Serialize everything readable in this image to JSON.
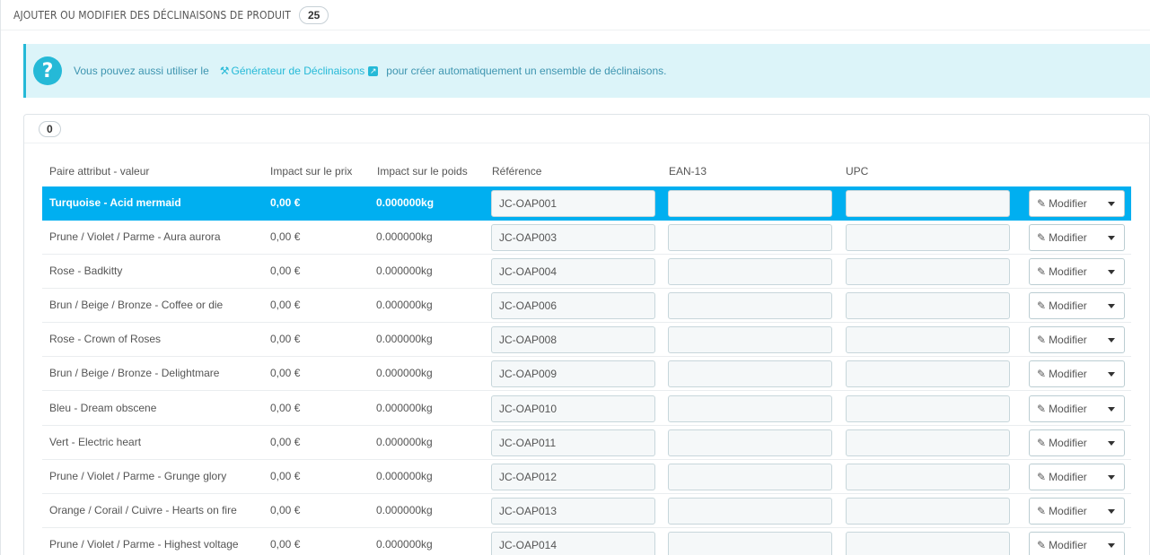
{
  "header": {
    "title": "AJOUTER OU MODIFIER DES DÉCLINAISONS DE PRODUIT",
    "count": "25"
  },
  "alert": {
    "before": "Vous pouvez aussi utiliser le",
    "link": "Générateur de Déclinaisons",
    "after": "pour créer automatiquement un ensemble de déclinaisons."
  },
  "panel": {
    "count": "0"
  },
  "table": {
    "columns": [
      "Paire attribut - valeur",
      "Impact sur le prix",
      "Impact sur le poids",
      "Référence",
      "EAN-13",
      "UPC"
    ],
    "action_label": "Modifier",
    "rows": [
      {
        "name": "Turquoise - Acid mermaid",
        "price": "0,00 €",
        "weight": "0.000000kg",
        "ref": "JC-OAP001",
        "ean": "",
        "upc": ""
      },
      {
        "name": "Prune / Violet / Parme - Aura aurora",
        "price": "0,00 €",
        "weight": "0.000000kg",
        "ref": "JC-OAP003",
        "ean": "",
        "upc": ""
      },
      {
        "name": "Rose - Badkitty",
        "price": "0,00 €",
        "weight": "0.000000kg",
        "ref": "JC-OAP004",
        "ean": "",
        "upc": ""
      },
      {
        "name": "Brun / Beige / Bronze - Coffee or die",
        "price": "0,00 €",
        "weight": "0.000000kg",
        "ref": "JC-OAP006",
        "ean": "",
        "upc": ""
      },
      {
        "name": "Rose - Crown of Roses",
        "price": "0,00 €",
        "weight": "0.000000kg",
        "ref": "JC-OAP008",
        "ean": "",
        "upc": ""
      },
      {
        "name": "Brun / Beige / Bronze - Delightmare",
        "price": "0,00 €",
        "weight": "0.000000kg",
        "ref": "JC-OAP009",
        "ean": "",
        "upc": ""
      },
      {
        "name": "Bleu - Dream obscene",
        "price": "0,00 €",
        "weight": "0.000000kg",
        "ref": "JC-OAP010",
        "ean": "",
        "upc": ""
      },
      {
        "name": "Vert - Electric heart",
        "price": "0,00 €",
        "weight": "0.000000kg",
        "ref": "JC-OAP011",
        "ean": "",
        "upc": ""
      },
      {
        "name": "Prune / Violet / Parme - Grunge glory",
        "price": "0,00 €",
        "weight": "0.000000kg",
        "ref": "JC-OAP012",
        "ean": "",
        "upc": ""
      },
      {
        "name": "Orange / Corail / Cuivre - Hearts on fire",
        "price": "0,00 €",
        "weight": "0.000000kg",
        "ref": "JC-OAP013",
        "ean": "",
        "upc": ""
      },
      {
        "name": "Prune / Violet / Parme - Highest voltage",
        "price": "0,00 €",
        "weight": "0.000000kg",
        "ref": "JC-OAP014",
        "ean": "",
        "upc": ""
      }
    ]
  },
  "colors": {
    "accent": "#25b9d7",
    "selected_row": "#00aff0",
    "alert_bg": "#dcf4f9"
  },
  "icons": {
    "help": "question-circle-icon",
    "link": "magic-wand-icon",
    "external": "external-link-icon",
    "edit": "pencil-icon",
    "dropdown": "caret-down-icon"
  }
}
